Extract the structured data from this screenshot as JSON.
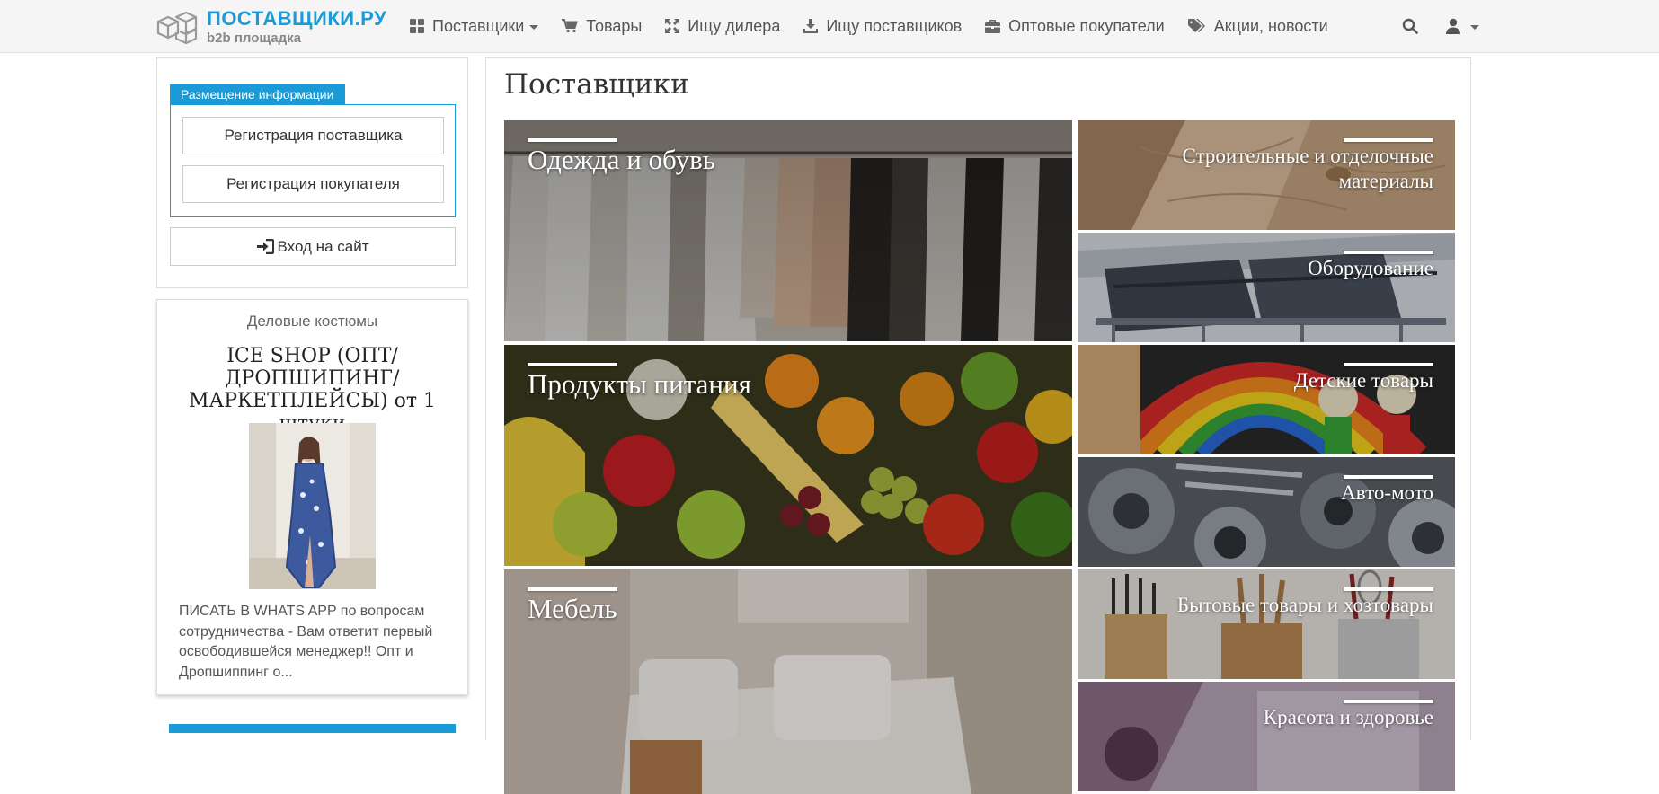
{
  "header": {
    "logo_title": "ПОСТАВЩИКИ.РУ",
    "logo_subtitle": "b2b площадка",
    "nav": [
      {
        "label": "Поставщики",
        "icon": "grid-icon",
        "dropdown": true
      },
      {
        "label": "Товары",
        "icon": "cart-icon"
      },
      {
        "label": "Ищу дилера",
        "icon": "expand-arrows-icon"
      },
      {
        "label": "Ищу поставщиков",
        "icon": "download-icon"
      },
      {
        "label": "Оптовые покупатели",
        "icon": "briefcase-icon"
      },
      {
        "label": "Акции, новости",
        "icon": "tags-icon"
      }
    ]
  },
  "sidebar": {
    "info_tab": "Размещение информации",
    "register_supplier": "Регистрация поставщика",
    "register_buyer": "Регистрация покупателя",
    "login": "Вход на сайт",
    "ad": {
      "category": "Деловые костюмы",
      "title": "ICE SHOP (ОПТ/ДРОПШИПИНГ/МАРКЕТПЛЕЙСЫ) от 1 штуки",
      "description": "ПИСАТЬ В WHATS APP по вопросам сотрудничества - Вам ответит первый освободившейся менеджер!! Опт и Дропшиппинг о..."
    }
  },
  "main": {
    "title": "Поставщики",
    "categories": {
      "clothes": "Одежда и обувь",
      "building": "Строительные и отделочные материалы",
      "equipment": "Оборудование",
      "food": "Продукты питания",
      "kids": "Детские товары",
      "auto": "Авто-мото",
      "furniture": "Мебель",
      "household": "Бытовые товары и хозтовары",
      "beauty": "Красота и здоровье"
    }
  },
  "colors": {
    "accent": "#1a9bd7",
    "navbar_bg": "#f5f5f5"
  }
}
